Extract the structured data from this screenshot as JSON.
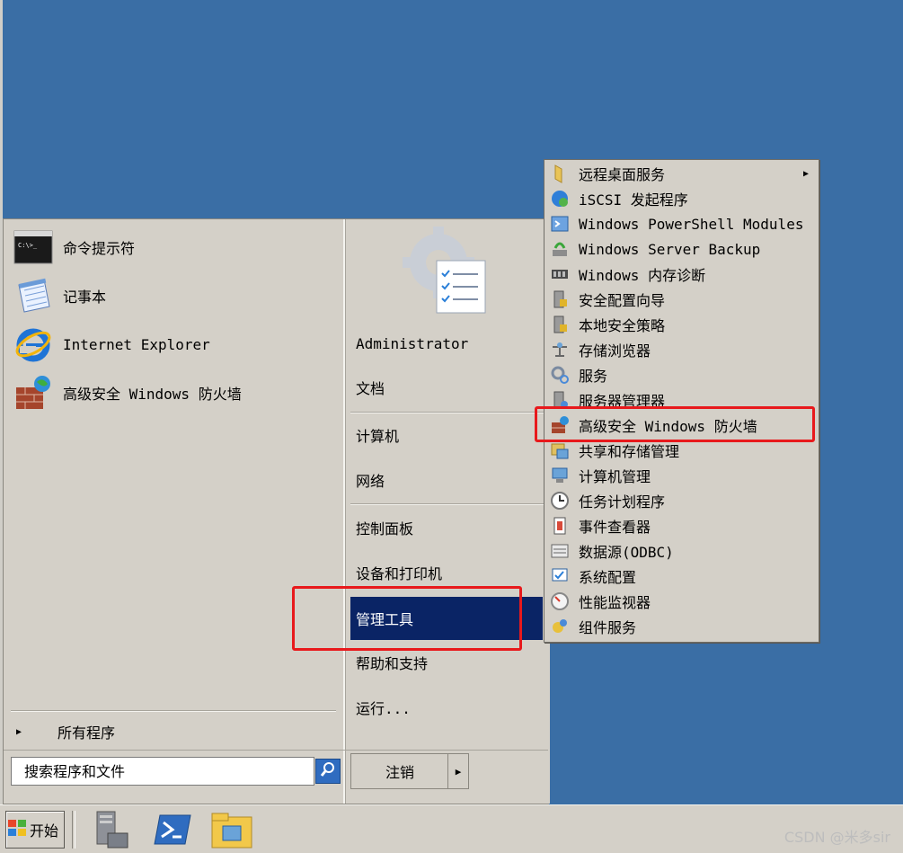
{
  "start_menu": {
    "pinned": [
      {
        "label": "命令提示符",
        "icon": "cmd-icon"
      },
      {
        "label": "记事本",
        "icon": "notepad-icon"
      },
      {
        "label": "Internet Explorer",
        "icon": "ie-icon"
      },
      {
        "label": "高级安全 Windows 防火墙",
        "icon": "firewall-icon"
      }
    ],
    "all_programs": "所有程序",
    "search_placeholder": "搜索程序和文件",
    "right": {
      "user": "Administrator",
      "documents": "文档",
      "computer": "计算机",
      "network": "网络",
      "control_panel": "控制面板",
      "devices_printers": "设备和打印机",
      "admin_tools": "管理工具",
      "help": "帮助和支持",
      "run": "运行..."
    },
    "logoff": "注销"
  },
  "submenu": {
    "items": [
      {
        "label": "远程桌面服务",
        "icon": "folder-icon",
        "has_submenu": true
      },
      {
        "label": "iSCSI 发起程序",
        "icon": "iscsi-icon"
      },
      {
        "label": "Windows PowerShell Modules",
        "icon": "powershell-modules-icon"
      },
      {
        "label": "Windows Server Backup",
        "icon": "backup-icon"
      },
      {
        "label": "Windows 内存诊断",
        "icon": "memory-icon"
      },
      {
        "label": "安全配置向导",
        "icon": "security-wizard-icon"
      },
      {
        "label": "本地安全策略",
        "icon": "local-policy-icon"
      },
      {
        "label": "存储浏览器",
        "icon": "storage-explorer-icon"
      },
      {
        "label": "服务",
        "icon": "services-icon"
      },
      {
        "label": "服务器管理器",
        "icon": "server-manager-icon"
      },
      {
        "label": "高级安全 Windows 防火墙",
        "icon": "firewall-icon"
      },
      {
        "label": "共享和存储管理",
        "icon": "share-storage-icon"
      },
      {
        "label": "计算机管理",
        "icon": "computer-management-icon"
      },
      {
        "label": "任务计划程序",
        "icon": "task-scheduler-icon"
      },
      {
        "label": "事件查看器",
        "icon": "event-viewer-icon"
      },
      {
        "label": "数据源(ODBC)",
        "icon": "odbc-icon"
      },
      {
        "label": "系统配置",
        "icon": "system-config-icon"
      },
      {
        "label": "性能监视器",
        "icon": "performance-monitor-icon"
      },
      {
        "label": "组件服务",
        "icon": "component-services-icon"
      }
    ]
  },
  "taskbar": {
    "start_label": "开始",
    "watermark": "CSDN @米多sir"
  },
  "colors": {
    "desktop": "#3a6ea5",
    "highlight": "#0a2465",
    "annotation": "#e8191c"
  }
}
